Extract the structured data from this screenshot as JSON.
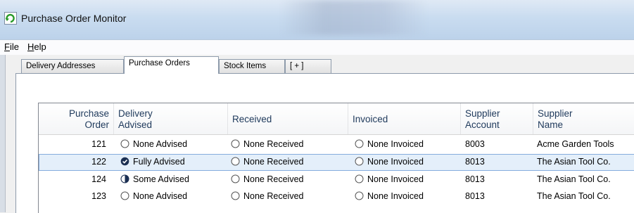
{
  "window": {
    "title": "Purchase Order Monitor"
  },
  "menu": {
    "file": "File",
    "file_hotkey": "F",
    "file_rest": "ile",
    "help": "Help",
    "help_hotkey": "H",
    "help_rest": "elp"
  },
  "tabs": [
    {
      "label": "Delivery Addresses",
      "active": false
    },
    {
      "label": "Purchase Orders",
      "active": true
    },
    {
      "label": "Stock Items",
      "active": false
    },
    {
      "label": "[ + ]",
      "active": false
    }
  ],
  "table": {
    "columns": [
      {
        "line1": "Purchase",
        "line2": "Order"
      },
      {
        "line1": "Delivery",
        "line2": "Advised"
      },
      {
        "line1": "Received",
        "line2": ""
      },
      {
        "line1": "Invoiced",
        "line2": ""
      },
      {
        "line1": "Supplier",
        "line2": "Account"
      },
      {
        "line1": "Supplier",
        "line2": "Name"
      }
    ],
    "rows": [
      {
        "order": "121",
        "delivery_icon": "radio-empty-icon",
        "delivery": "None Advised",
        "received": "None Received",
        "invoiced": "None Invoiced",
        "account": "8003",
        "name": "Acme Garden Tools",
        "selected": false
      },
      {
        "order": "122",
        "delivery_icon": "radio-full-icon",
        "delivery": "Fully Advised",
        "received": "None Received",
        "invoiced": "None Invoiced",
        "account": "8013",
        "name": "The Asian Tool Co.",
        "selected": true
      },
      {
        "order": "124",
        "delivery_icon": "radio-half-icon",
        "delivery": "Some Advised",
        "received": "None Received",
        "invoiced": "None Invoiced",
        "account": "8013",
        "name": "The Asian Tool Co.",
        "selected": false
      },
      {
        "order": "123",
        "delivery_icon": "radio-empty-icon",
        "delivery": "None Advised",
        "received": "None Received",
        "invoiced": "None Invoiced",
        "account": "8013",
        "name": "The Asian Tool Co.",
        "selected": false
      }
    ]
  },
  "colors": {
    "accent": "#1e395b",
    "selection": "#e4effa",
    "selection_border": "#84acdd"
  }
}
